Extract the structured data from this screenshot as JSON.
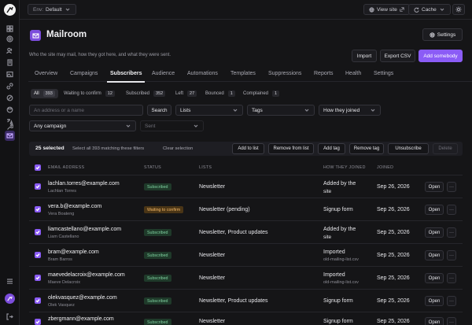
{
  "topbar": {
    "env_prefix": "Env:",
    "env_value": "Default",
    "view_site": "View site",
    "cache": "Cache"
  },
  "header": {
    "title": "Mailroom",
    "subtitle": "Who the site may mail, how they got here, and what they were sent.",
    "settings": "Settings",
    "import": "Import",
    "export": "Export CSV",
    "add": "Add somebody"
  },
  "tabs": [
    "Overview",
    "Campaigns",
    "Subscribers",
    "Audience",
    "Automations",
    "Templates",
    "Suppressions",
    "Reports",
    "Health",
    "Settings"
  ],
  "segments": [
    {
      "label": "All",
      "count": "393"
    },
    {
      "label": "Waiting to confirm",
      "count": "12"
    },
    {
      "label": "Subscribed",
      "count": "352"
    },
    {
      "label": "Left",
      "count": "27"
    },
    {
      "label": "Bounced",
      "count": "1"
    },
    {
      "label": "Complained",
      "count": "1"
    }
  ],
  "filters": {
    "search_placeholder": "An address or a name",
    "search_button": "Search",
    "lists": "Lists",
    "tags": "Tags",
    "how": "How they joined",
    "campaign": "Any campaign",
    "sent": "Sent"
  },
  "bulk": {
    "selected": "25 selected",
    "select_all": "Select all 393 matching these filters",
    "clear": "Clear selection",
    "add_to_list": "Add to list",
    "remove_from_list": "Remove from list",
    "add_tag": "Add tag",
    "remove_tag": "Remove tag",
    "unsubscribe": "Unsubscribe",
    "delete": "Delete"
  },
  "table": {
    "headers": {
      "email": "EMAIL ADDRESS",
      "status": "STATUS",
      "lists": "LISTS",
      "how": "HOW THEY JOINED",
      "joined": "JOINED"
    },
    "open_label": "Open",
    "more_label": "···",
    "rows": [
      {
        "email": "lachlan.torres@example.com",
        "name": "Lachlan Torres",
        "status": "Subscribed",
        "lists": "Newsletter",
        "how1": "Added by the",
        "how2": "site",
        "joined": "Sep 26, 2026"
      },
      {
        "email": "vera.b@example.com",
        "name": "Vera Boateng",
        "status": "Waiting to confirm",
        "lists": "Newsletter (pending)",
        "how1": "Signup form",
        "how2": "",
        "joined": "Sep 26, 2026"
      },
      {
        "email": "liamcastellano@example.com",
        "name": "Liam Castellano",
        "status": "Subscribed",
        "lists": "Newsletter, Product updates",
        "how1": "Added by the",
        "how2": "site",
        "joined": "Sep 25, 2026"
      },
      {
        "email": "bram@example.com",
        "name": "Bram Barros",
        "status": "Subscribed",
        "lists": "Newsletter",
        "how1": "Imported",
        "how2": "old-mailing-list.csv",
        "joined": "Sep 25, 2026"
      },
      {
        "email": "maevedelacroix@example.com",
        "name": "Maeve Delacroix",
        "status": "Subscribed",
        "lists": "Newsletter",
        "how1": "Imported",
        "how2": "old-mailing-list.csv",
        "joined": "Sep 25, 2026"
      },
      {
        "email": "olekvasquez@example.com",
        "name": "Olek Vasquez",
        "status": "Subscribed",
        "lists": "Newsletter, Product updates",
        "how1": "Signup form",
        "how2": "",
        "joined": "Sep 25, 2026"
      },
      {
        "email": "zbergmann@example.com",
        "name": "",
        "status": "Subscribed",
        "lists": "Newsletter",
        "how1": "Signup form",
        "how2": "",
        "joined": "Sep 25, 2026"
      }
    ]
  }
}
